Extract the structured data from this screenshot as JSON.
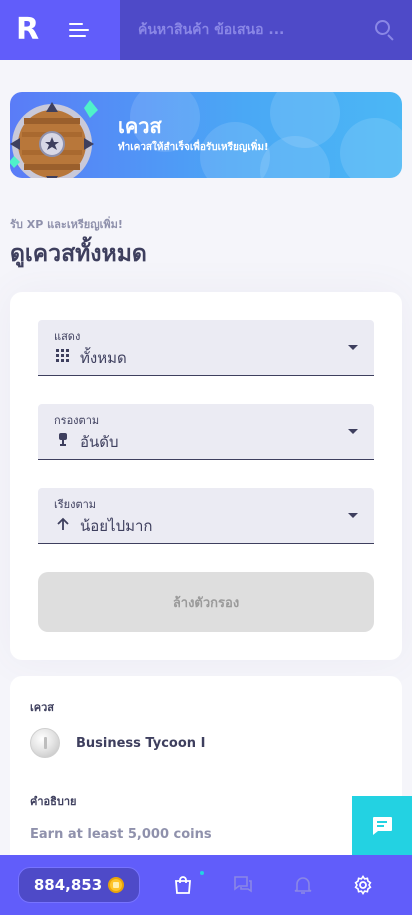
{
  "header": {
    "logo": "R",
    "search_placeholder": "ค้นหาสินค้า ข้อเสนอ ..."
  },
  "banner": {
    "title": "เควส",
    "subtitle": "ทำเควสให้สำเร็จเพื่อรับเหรียญเพิ่ม!"
  },
  "section": {
    "pretitle": "รับ XP และเหรียญเพิ่ม!",
    "title": "ดูเควสทั้งหมด"
  },
  "filters": {
    "show": {
      "label": "แสดง",
      "value": "ทั้งหมด",
      "icon": "grid-icon"
    },
    "filter_by": {
      "label": "กรองตาม",
      "value": "อันดับ",
      "icon": "rank-icon"
    },
    "sort_by": {
      "label": "เรียงตาม",
      "value": "น้อยไปมาก",
      "icon": "arrow-up-icon"
    },
    "clear_label": "ล้างตัวกรอง"
  },
  "quest": {
    "quest_label": "เควส",
    "name": "Business Tycoon I",
    "description_label": "คำอธิบาย",
    "description": "Earn at least 5,000 coins"
  },
  "bottom_nav": {
    "coins": "884,853",
    "items": [
      "shopping-bag-icon",
      "messages-icon",
      "bell-icon",
      "settings-icon"
    ]
  },
  "colors": {
    "primary": "#615dfa",
    "secondary": "#23d2e2",
    "dark": "#3e3f5e"
  }
}
